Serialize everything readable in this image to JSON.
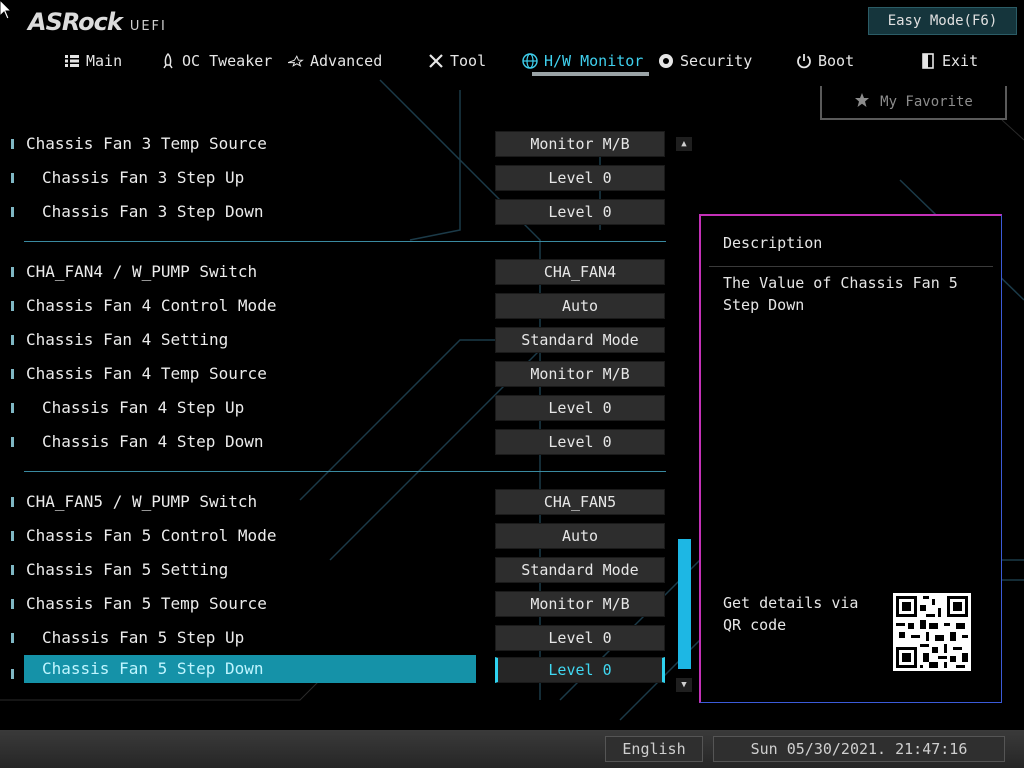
{
  "header": {
    "logo_text": "ASRock",
    "logo_suffix": "UEFI",
    "easy_mode_label": "Easy Mode(F6)"
  },
  "nav": {
    "tabs": [
      {
        "label": "Main",
        "icon": "list-icon"
      },
      {
        "label": "OC Tweaker",
        "icon": "rocket-icon"
      },
      {
        "label": "Advanced",
        "icon": "star-outline-icon"
      },
      {
        "label": "Tool",
        "icon": "tools-icon"
      },
      {
        "label": "H/W Monitor",
        "icon": "globe-icon",
        "active": true
      },
      {
        "label": "Security",
        "icon": "shield-icon"
      },
      {
        "label": "Boot",
        "icon": "power-icon"
      },
      {
        "label": "Exit",
        "icon": "exit-icon"
      }
    ]
  },
  "favorite": {
    "label": "My Favorite",
    "icon": "star-icon"
  },
  "settings": [
    {
      "label": "Chassis Fan 3 Temp Source",
      "value": "Monitor M/B"
    },
    {
      "label": "Chassis Fan 3 Step Up",
      "value": "Level 0"
    },
    {
      "label": "Chassis Fan 3 Step Down",
      "value": "Level 0"
    },
    {
      "label": "CHA_FAN4 / W_PUMP Switch",
      "value": "CHA_FAN4"
    },
    {
      "label": "Chassis Fan 4 Control Mode",
      "value": "Auto"
    },
    {
      "label": "Chassis Fan 4 Setting",
      "value": "Standard Mode"
    },
    {
      "label": "Chassis Fan 4 Temp Source",
      "value": "Monitor M/B"
    },
    {
      "label": "Chassis Fan 4 Step Up",
      "value": "Level 0"
    },
    {
      "label": "Chassis Fan 4 Step Down",
      "value": "Level 0"
    },
    {
      "label": "CHA_FAN5 / W_PUMP Switch",
      "value": "CHA_FAN5"
    },
    {
      "label": "Chassis Fan 5 Control Mode",
      "value": "Auto"
    },
    {
      "label": "Chassis Fan 5 Setting",
      "value": "Standard Mode"
    },
    {
      "label": "Chassis Fan 5 Temp Source",
      "value": "Monitor M/B"
    },
    {
      "label": "Chassis Fan 5 Step Up",
      "value": "Level 0"
    },
    {
      "label": "Chassis Fan 5 Step Down",
      "value": "Level 0",
      "selected": true
    }
  ],
  "description": {
    "title": "Description",
    "text": "The Value of Chassis Fan 5 Step Down",
    "qr_text": "Get details via QR code"
  },
  "footer": {
    "language": "English",
    "datetime": "Sun 05/30/2021. 21:47:16"
  },
  "colors": {
    "accent": "#3fd0ee",
    "selected_row": "#1592a8",
    "scroll_thumb": "#1db7e4",
    "desc_border_pink": "#c431b8",
    "desc_border_blue": "#3b5bd9"
  }
}
